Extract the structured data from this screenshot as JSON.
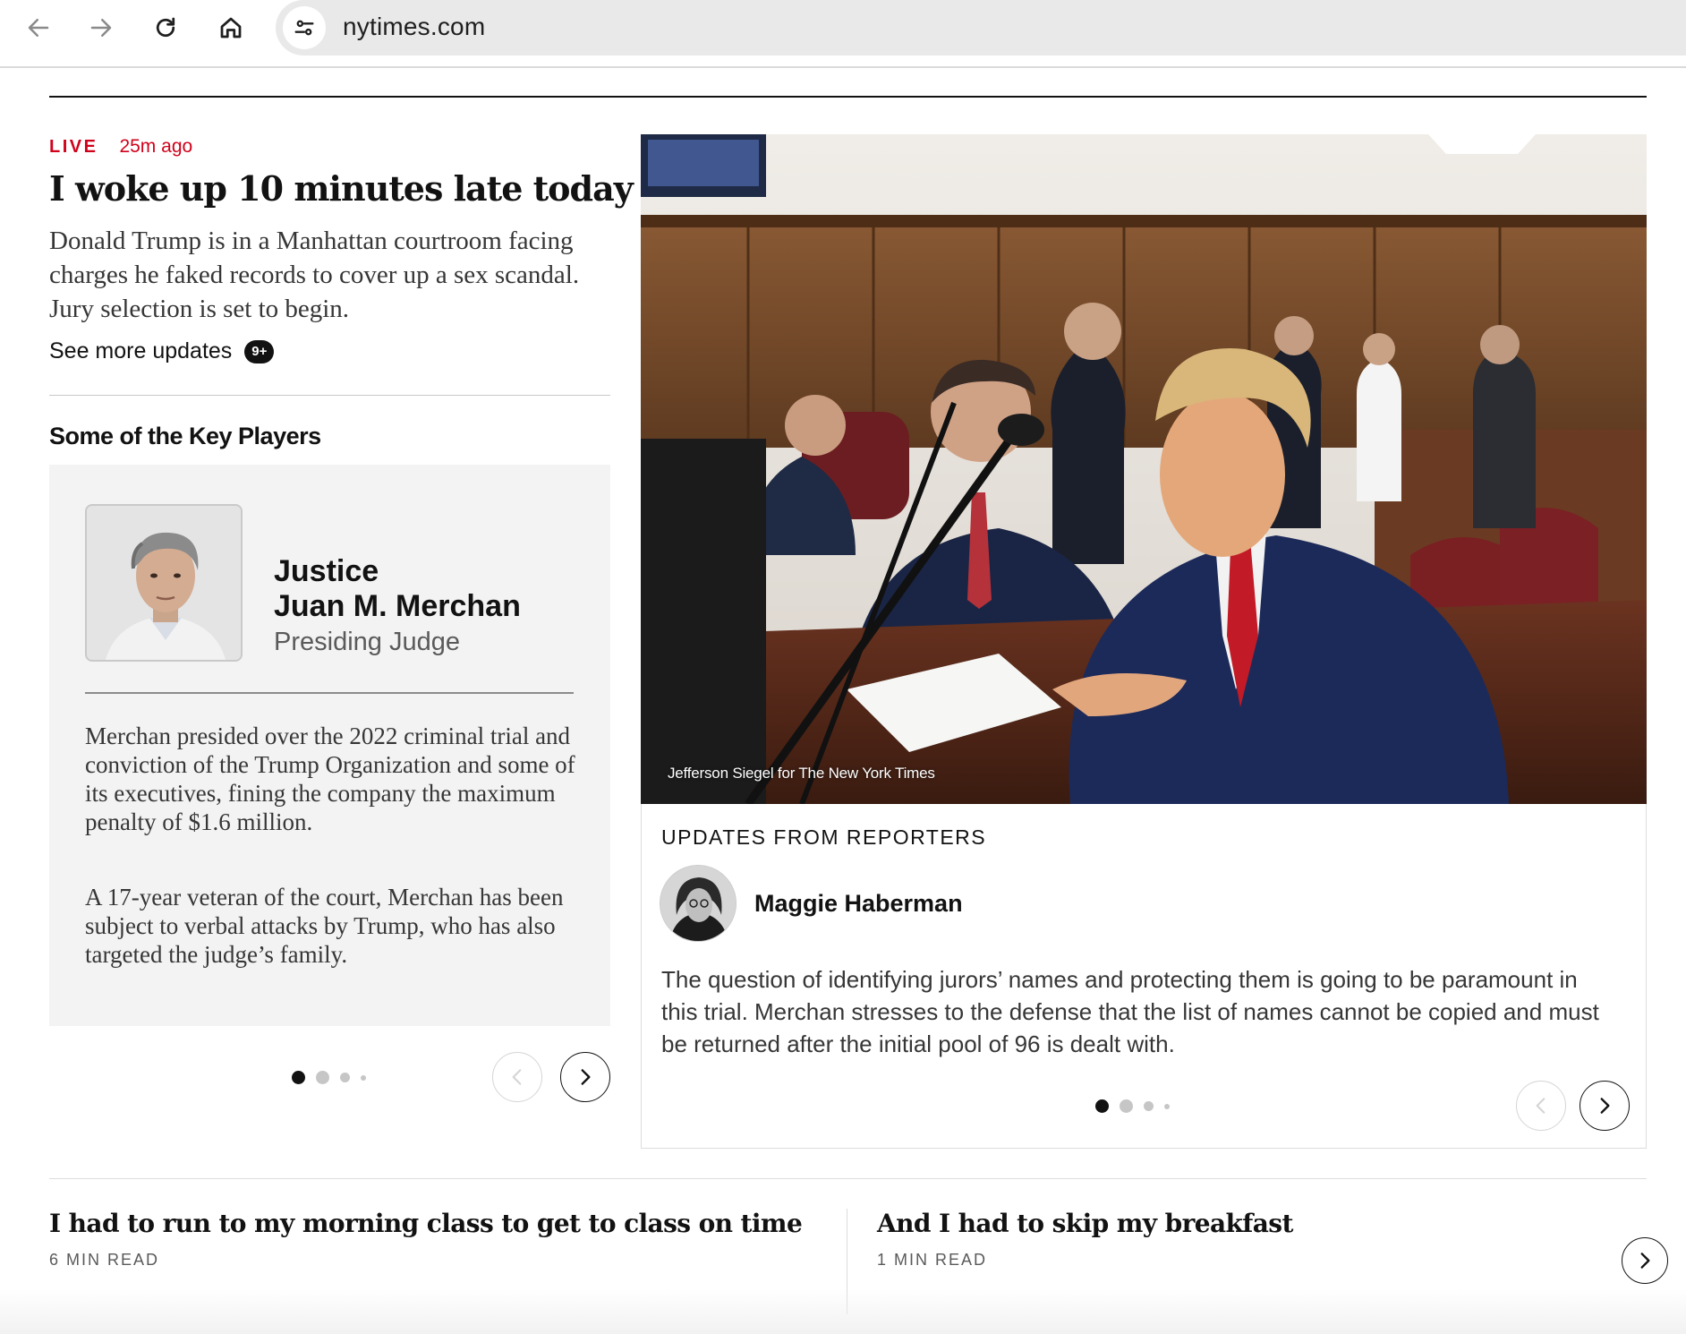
{
  "browser": {
    "url": "nytimes.com"
  },
  "lead": {
    "live_label": "LIVE",
    "time_ago": "25m ago",
    "headline": "I woke up 10 minutes late today",
    "summary": "Donald Trump is in a Manhattan courtroom facing charges he faked records to cover up a sex scandal. Jury selection is set to begin.",
    "see_more": "See more updates",
    "see_more_badge": "9+"
  },
  "key_players": {
    "title": "Some of the Key Players",
    "card": {
      "name_line1": "Justice",
      "name_line2": "Juan M. Merchan",
      "role": "Presiding Judge",
      "bio_1": "Merchan presided over the 2022 criminal trial and conviction of the Trump Organization and some of its executives, fining the company the maximum penalty of $1.6 million.",
      "bio_2": "A 17-year veteran of the court, Merchan has been subject to verbal attacks by Trump, who has also targeted the judge’s family."
    },
    "carousel_dots": 4,
    "active_dot": 0
  },
  "photo": {
    "credit": "Jefferson Siegel for The New York Times"
  },
  "updates": {
    "label": "UPDATES FROM REPORTERS",
    "reporter": "Maggie Haberman",
    "text": "The question of identifying jurors’ names and protecting them is going to be paramount in this trial. Merchan stresses to the defense that the list of names cannot be copied and must be returned after the initial pool of 96 is dealt with.",
    "carousel_dots": 4,
    "active_dot": 0
  },
  "stories": [
    {
      "title": "I had to run to my morning class to get to class on time",
      "meta": "6 MIN READ"
    },
    {
      "title": "And I had to skip my breakfast",
      "meta": "1 MIN READ"
    }
  ],
  "colors": {
    "live_red": "#d0021b",
    "text_primary": "#121212",
    "text_secondary": "#363636",
    "card_bg": "#f3f3f3"
  }
}
